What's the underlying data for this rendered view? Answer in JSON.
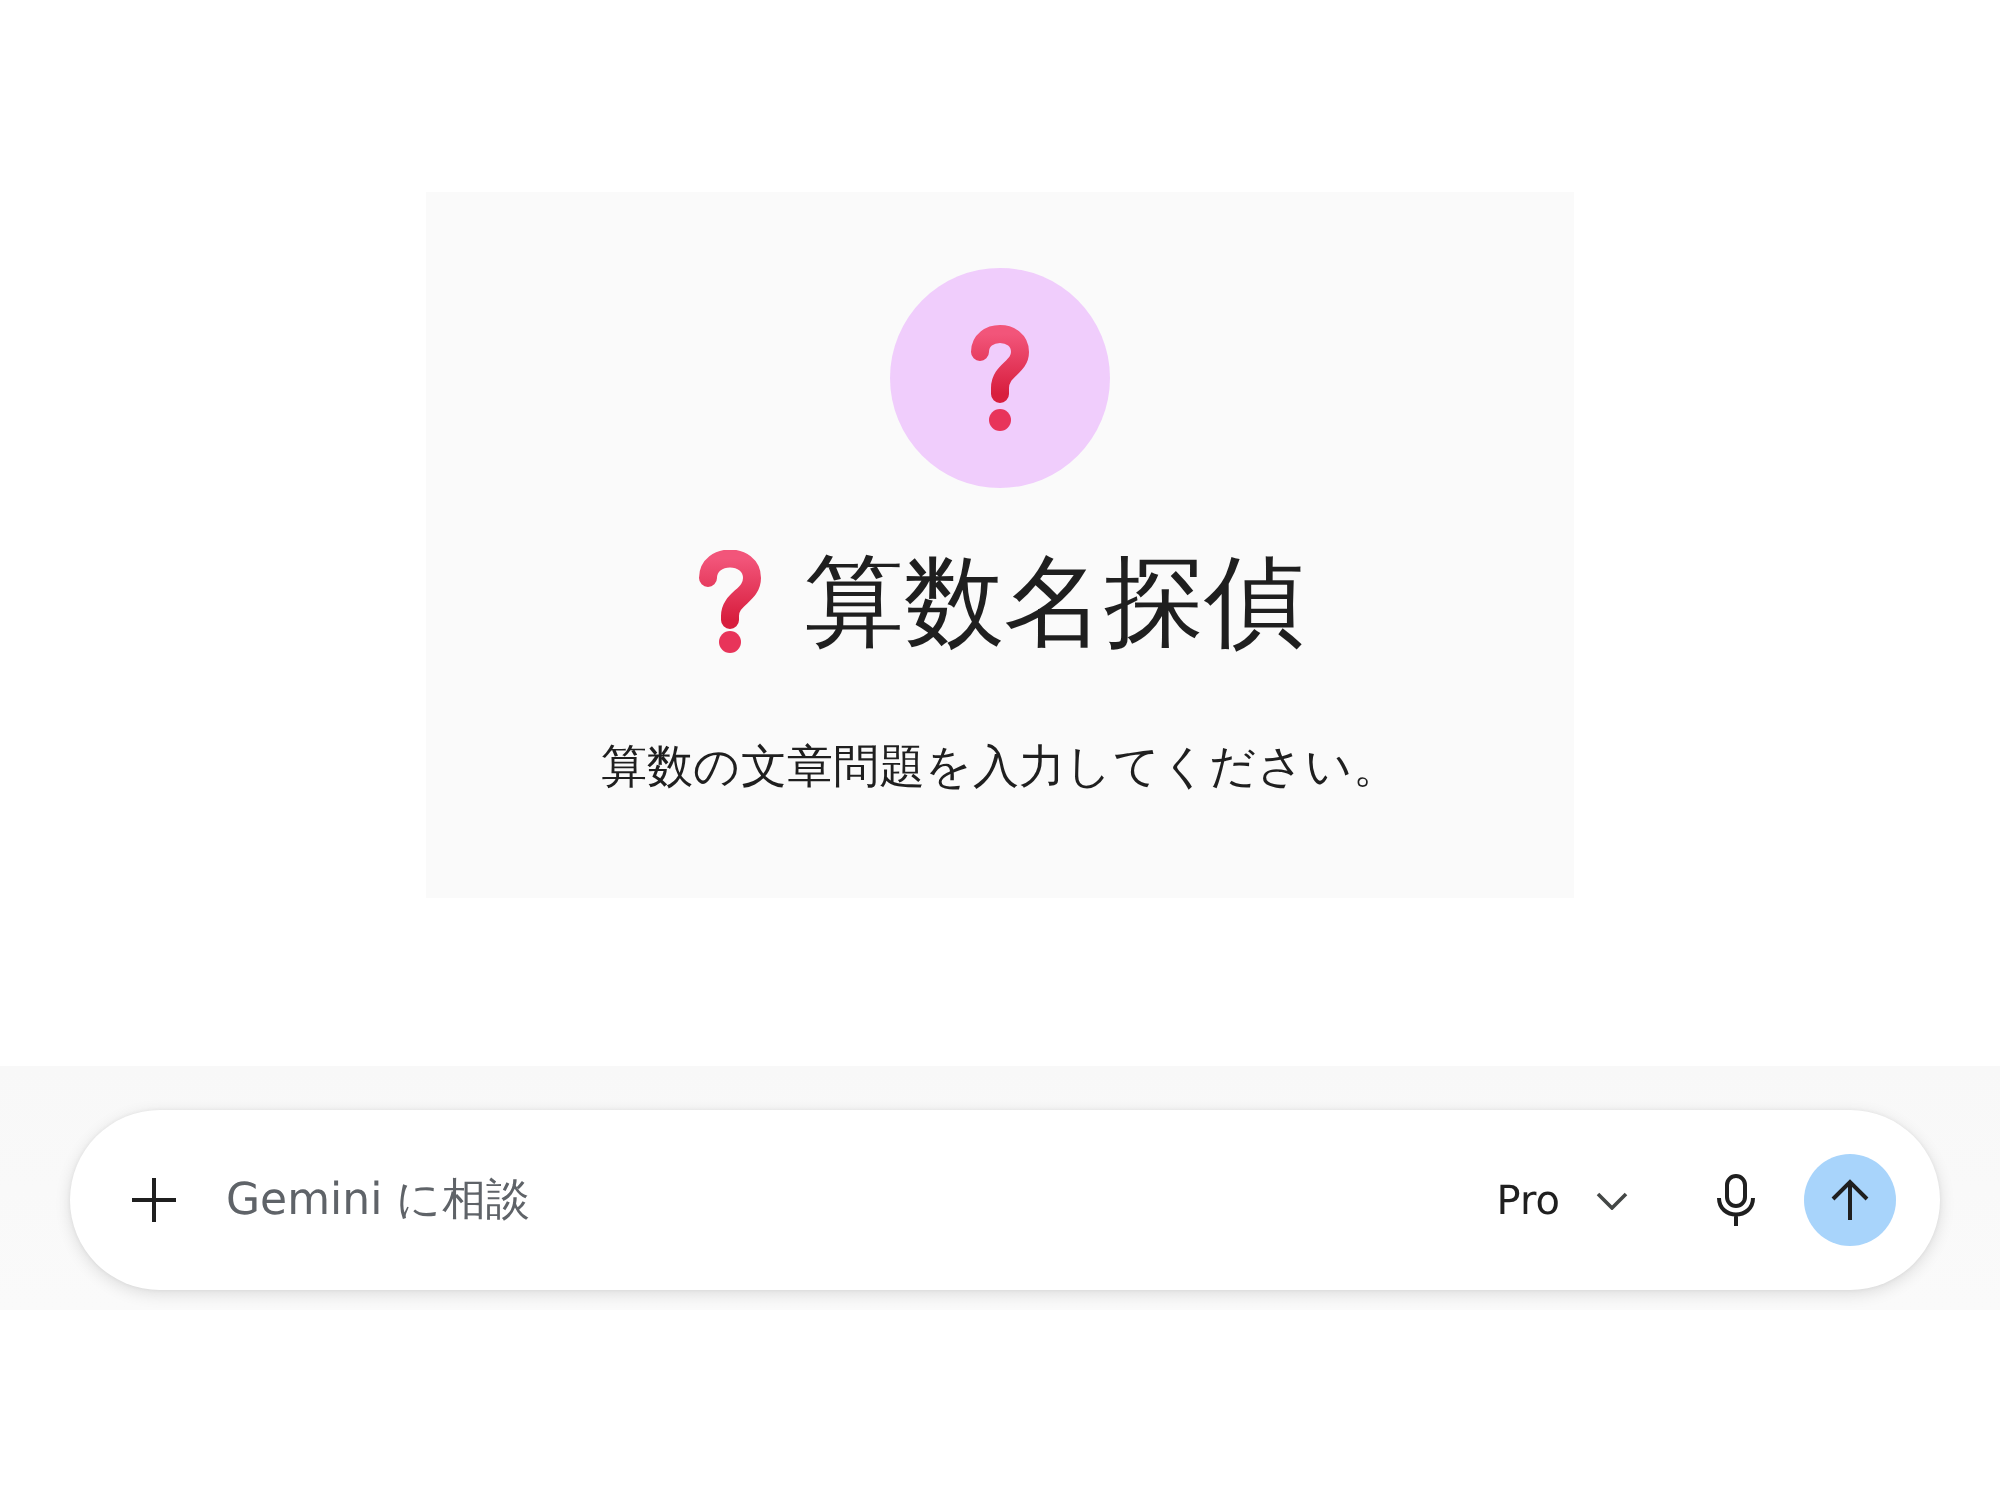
{
  "gem": {
    "title": "算数名探偵",
    "description": "算数の文章問題を入力してください。"
  },
  "prompt_bar": {
    "placeholder": "Gemini に相談",
    "model_picker": {
      "label": "Pro"
    }
  }
}
